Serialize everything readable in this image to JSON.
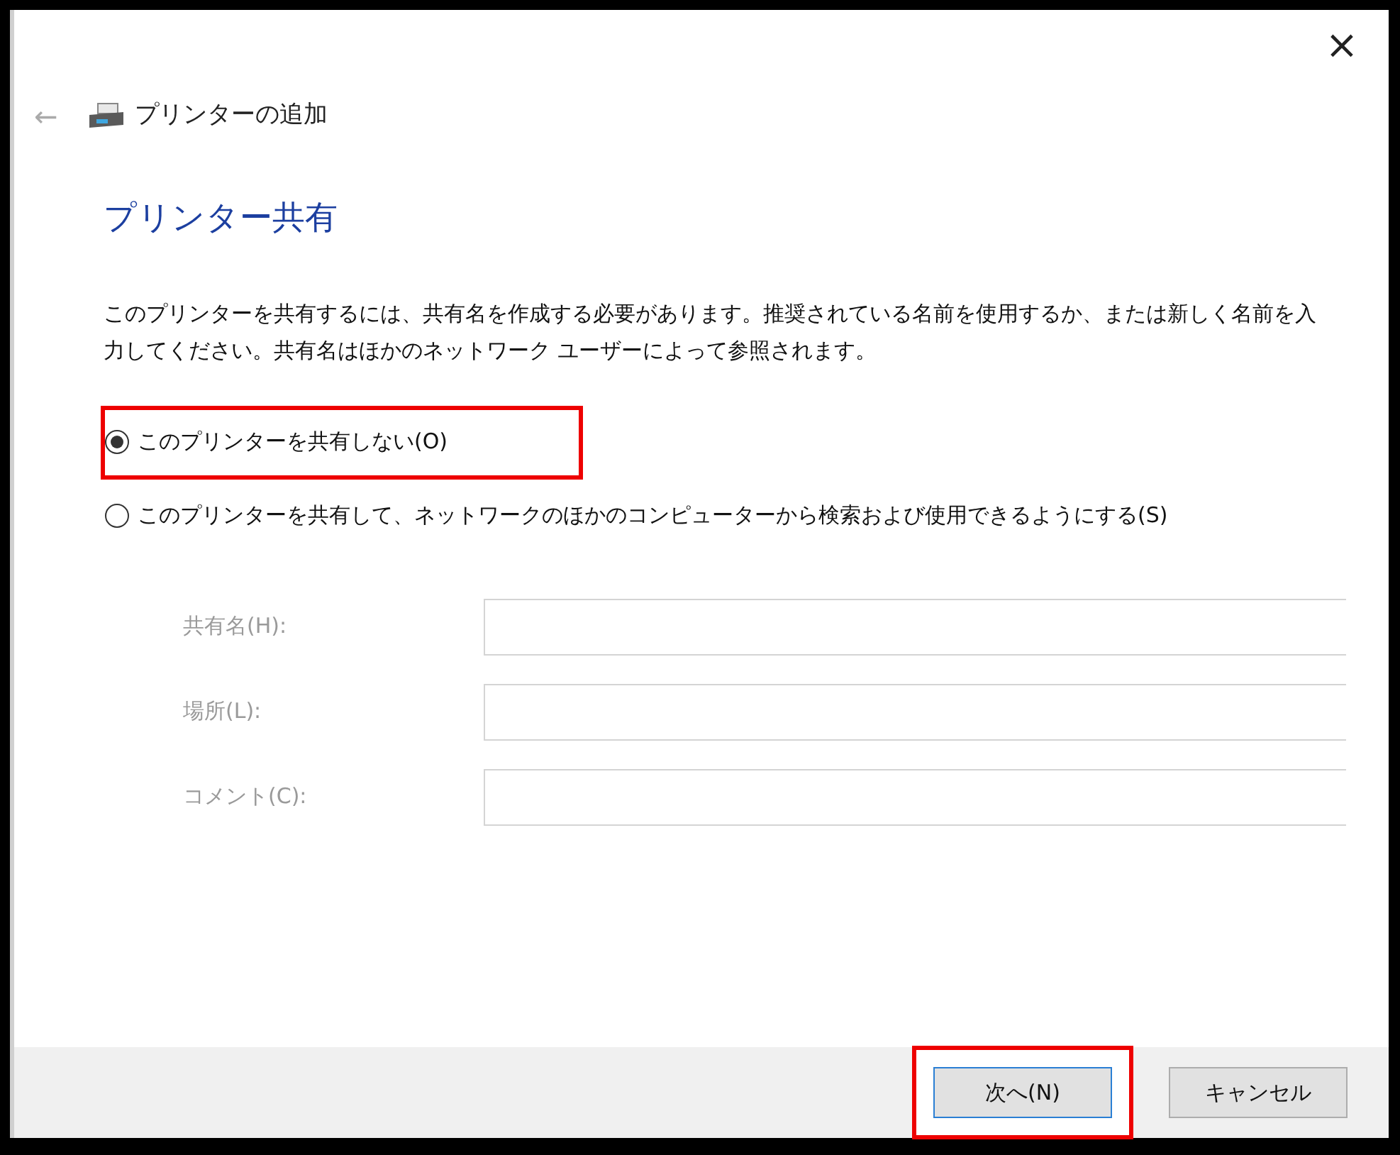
{
  "window": {
    "title": "プリンターの追加",
    "close": "×",
    "back": "←"
  },
  "heading": "プリンター共有",
  "description": "このプリンターを共有するには、共有名を作成する必要があります。推奨されている名前を使用するか、または新しく名前を入力してください。共有名はほかのネットワーク ユーザーによって参照されます。",
  "options": [
    {
      "label": "このプリンターを共有しない(O)",
      "selected": true,
      "highlighted": true
    },
    {
      "label": "このプリンターを共有して、ネットワークのほかのコンピューターから検索および使用できるようにする(S)",
      "selected": false,
      "highlighted": false
    }
  ],
  "fields": [
    {
      "label": "共有名(H):",
      "disabled": true
    },
    {
      "label": "場所(L):",
      "disabled": true
    },
    {
      "label": "コメント(C):",
      "disabled": true
    }
  ],
  "buttons": [
    {
      "label": "次へ(N)",
      "kind": "default",
      "highlighted": true
    },
    {
      "label": "キャンセル",
      "kind": "normal",
      "highlighted": false
    }
  ]
}
